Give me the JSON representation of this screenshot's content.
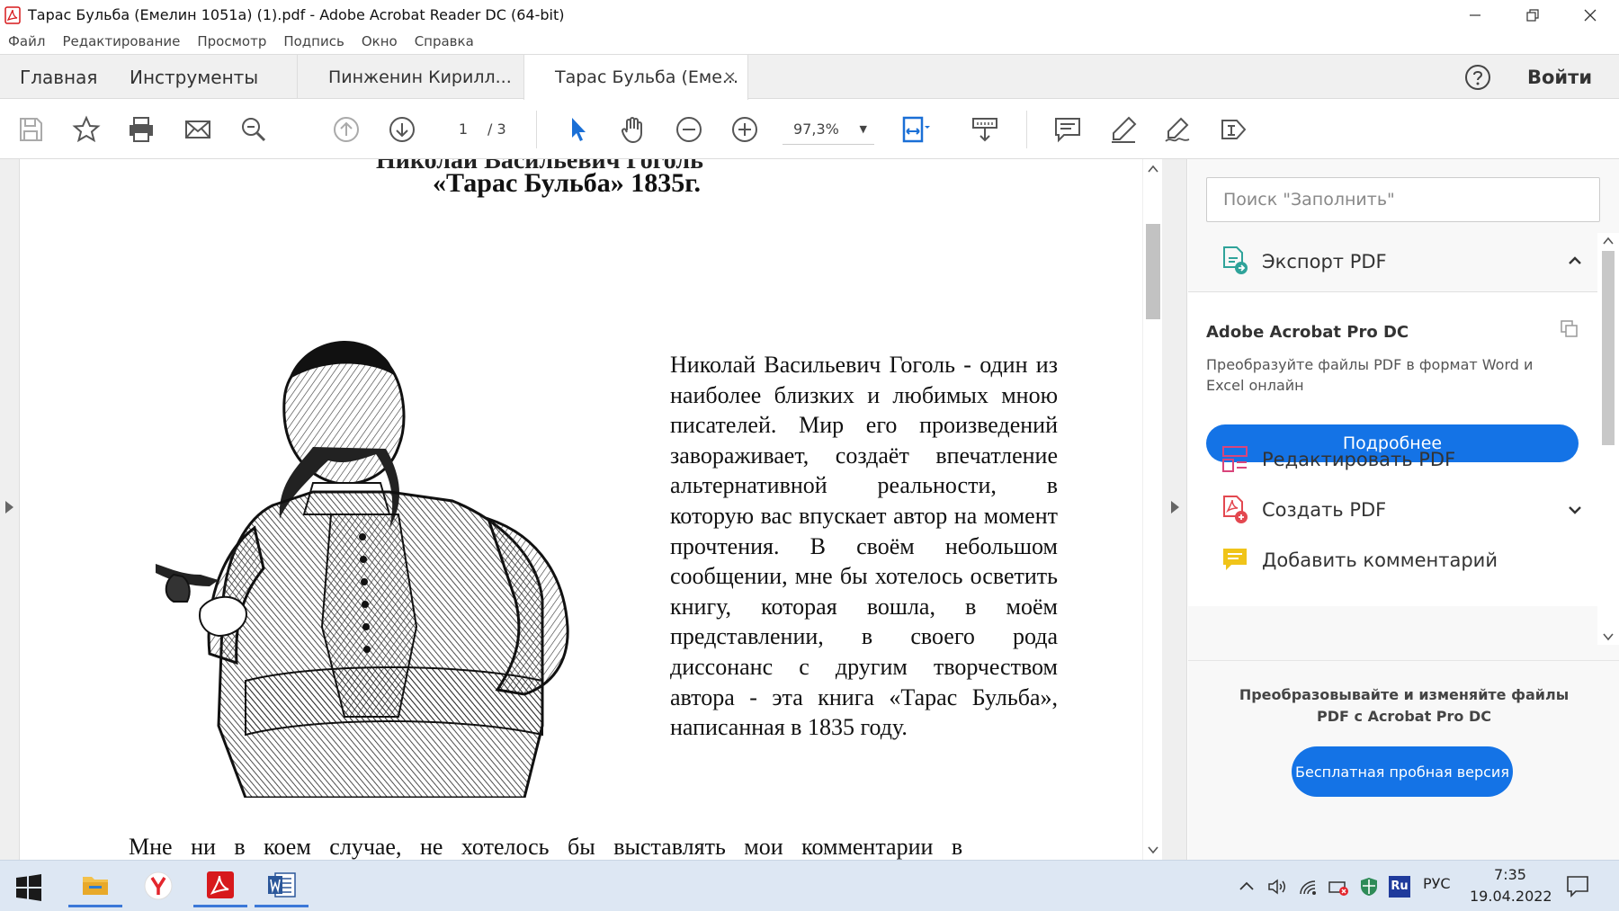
{
  "window": {
    "title": "Тарас Бульба (Емелин 1051а) (1).pdf - Adobe Acrobat Reader DC (64-bit)"
  },
  "menu": [
    "Файл",
    "Редактирование",
    "Просмотр",
    "Подпись",
    "Окно",
    "Справка"
  ],
  "tabs": {
    "home": "Главная",
    "tools": "Инструменты",
    "doc1": "Пинженин Кирилл...",
    "doc2": "Тарас Бульба (Еме...",
    "close": "×",
    "login": "Войти"
  },
  "toolbar": {
    "page_current": "1",
    "page_total": "/ 3",
    "zoom": "97,3%"
  },
  "document": {
    "heading_cut": "Николай Васильевич Гоголь",
    "heading": "«Тарас Бульба» 1835г.",
    "paragraph_1": "Николай Васильевич Гоголь - один из наиболее близких и любимых мною писателей. Мир его произведений завораживает, создаёт впечатление альтернативной реальности, в которую вас впускает автор на момент прочтения. В своём небольшом сообщении, мне бы хотелось осветить книгу, которая вошла, в моём представлении, в своего рода диссонанс с другим творчеством автора - эта книга «Тарас Бульба», написанная в 1835 году.",
    "paragraph_2": "Мне ни в коем случае, не хотелось бы выставлять мои комментарии в"
  },
  "pane": {
    "search_placeholder": "Поиск \"Заполнить\"",
    "export_label": "Экспорт PDF",
    "product_title": "Adobe Acrobat Pro DC",
    "product_desc": "Преобразуйте файлы PDF в формат Word и Excel онлайн",
    "more_button": "Подробнее",
    "edit_label": "Редактировать PDF",
    "create_label": "Создать PDF",
    "comment_label": "Добавить комментарий",
    "promo_text": "Преобразовывайте и изменяйте файлы PDF с Acrobat Pro DC",
    "trial_button": "Бесплатная пробная версия"
  },
  "taskbar": {
    "lang": "РУС",
    "time": "7:35",
    "date": "19.04.2022",
    "ru_badge": "Ru"
  },
  "colors": {
    "accent": "#1473e6",
    "acrobat_red": "#d7191c",
    "taskbar": "#dde7f3"
  }
}
